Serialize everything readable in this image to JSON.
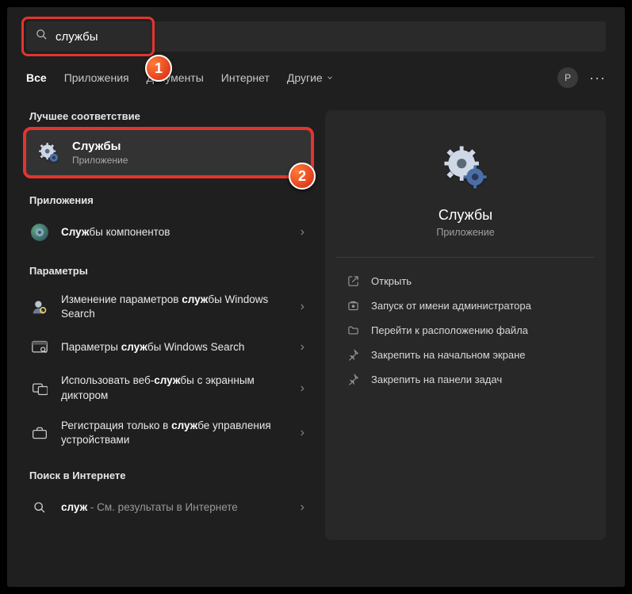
{
  "search": {
    "value": "службы"
  },
  "tabs": {
    "all": "Все",
    "apps": "Приложения",
    "docs": "Документы",
    "web": "Интернет",
    "more": "Другие"
  },
  "avatar": "P",
  "sections": {
    "best": "Лучшее соответствие",
    "apps": "Приложения",
    "params": "Параметры",
    "web": "Поиск в Интернете"
  },
  "best_match": {
    "title": "Службы",
    "subtitle": "Приложение"
  },
  "apps_list": [
    {
      "pre": "Служ",
      "bold": "бы",
      "post": " компонентов"
    }
  ],
  "params_list": [
    {
      "text": "Изменение параметров службы Windows Search",
      "html": "Изменение параметров <b>служ</b>бы Windows Search"
    },
    {
      "text": "Параметры службы Windows Search",
      "html": "Параметры <b>служ</b>бы Windows Search"
    },
    {
      "text": "Использовать веб-службы с экранным диктором",
      "html": "Использовать веб-<b>служ</b>бы с экранным диктором"
    },
    {
      "text": "Регистрация только в службе управления устройствами",
      "html": "Регистрация только в <b>служ</b>бе управления устройствами"
    }
  ],
  "web_list": [
    {
      "query": "служ",
      "suffix": " - См. результаты в Интернете"
    }
  ],
  "right": {
    "title": "Службы",
    "subtitle": "Приложение",
    "actions": {
      "open": "Открыть",
      "admin": "Запуск от имени администратора",
      "folder": "Перейти к расположению файла",
      "pin_start": "Закрепить на начальном экране",
      "pin_task": "Закрепить на панели задач"
    }
  },
  "badges": {
    "one": "1",
    "two": "2"
  }
}
